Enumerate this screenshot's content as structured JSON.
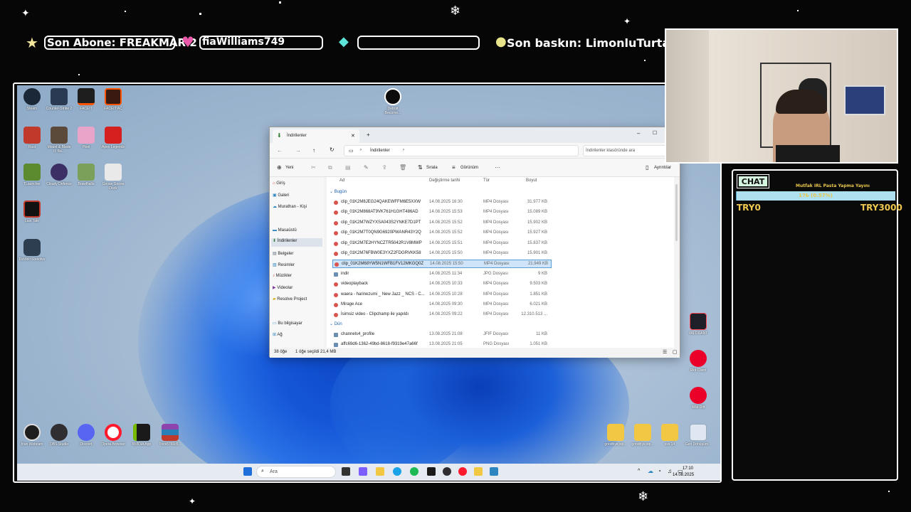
{
  "overlay": {
    "last_sub_label": "Son Abone: FREAKMAR 2",
    "last_tip": "fiaWilliams749",
    "blank_pill": "",
    "last_raid_label": "Son baskın: LimonluTurta",
    "icons": [
      "star-icon",
      "heart-icon",
      "diamond-icon",
      "coin-icon"
    ]
  },
  "desktop": {
    "icons_left": [
      {
        "label": "Steam"
      },
      {
        "label": "Counter-Strike 2"
      },
      {
        "label": "FACEIT"
      },
      {
        "label": "FACEIT AC"
      },
      {
        "label": "Rust"
      },
      {
        "label": "Mount & Blade II: Ba..."
      },
      {
        "label": "Pixel"
      },
      {
        "label": "Apex Legends"
      },
      {
        "label": "TLauncher"
      },
      {
        "label": "Cloudy Defence"
      },
      {
        "label": "Brawlhalla"
      },
      {
        "label": "Goose Goose Duck"
      },
      {
        "label": "Last Tale"
      },
      {
        "label": "DaVinci Resolve"
      }
    ],
    "icon_center": {
      "label": "Detroit Become..."
    },
    "icons_right": [
      {
        "label": "VALORANT"
      },
      {
        "label": "Riot Client"
      },
      {
        "label": "Wild Rift"
      }
    ],
    "icons_bottom": [
      {
        "label": "Iriun Webcam"
      },
      {
        "label": "OBS Studio"
      },
      {
        "label": "Discord"
      },
      {
        "label": "Opera Browser"
      },
      {
        "label": "NVIDIA App"
      },
      {
        "label": "Trick8766c6..."
      }
    ],
    "icons_bottom_right": [
      {
        "label": "goodbye.sip..."
      },
      {
        "label": "goodbye.sip..."
      },
      {
        "label": "sss 14"
      },
      {
        "label": "Geri Dönüşüm..."
      }
    ]
  },
  "explorer": {
    "tab_title": "İndirilenler",
    "breadcrumb": "İndirilenler",
    "search_placeholder": "İndirilenler klasöründe ara",
    "toolbar": {
      "new": "Yeni",
      "sort": "Sırala",
      "view": "Görünüm",
      "more": "···",
      "details": "Ayrıntılar"
    },
    "sidebar": [
      {
        "label": "Giriş",
        "pin": false
      },
      {
        "label": "Galeri",
        "pin": false
      },
      {
        "label": "Murathan - Kişi",
        "pin": false
      },
      {
        "label": "Masaüstü",
        "pin": true
      },
      {
        "label": "İndirilenler",
        "pin": true
      },
      {
        "label": "Belgeler",
        "pin": true
      },
      {
        "label": "Resimler",
        "pin": true
      },
      {
        "label": "Müzikler",
        "pin": true
      },
      {
        "label": "Videolar",
        "pin": true
      },
      {
        "label": "Resolve Project",
        "pin": false
      },
      {
        "label": "Bu bilgisayar",
        "pin": false
      },
      {
        "label": "Ağ",
        "pin": false
      }
    ],
    "columns": [
      "Ad",
      "Değiştirme tarihi",
      "Tür",
      "Boyut"
    ],
    "group_today": "Bugün",
    "group_yesterday": "Dün",
    "files_today": [
      {
        "name": "clip_01K2M8JEG24QAKEWFFM6E5XXW",
        "date": "14.08.2025 16:30",
        "type": "MP4 Dosyası",
        "size": "31.977 KB"
      },
      {
        "name": "clip_01K2M868AT9VK761H1GHT486AD",
        "date": "14.08.2025 15:53",
        "type": "MP4 Dosyası",
        "size": "15.089 KB"
      },
      {
        "name": "clip_01K2M7WZYXSA043S2YNKE7D1PT",
        "date": "14.08.2025 15:52",
        "type": "MP4 Dosyası",
        "size": "15.902 KB"
      },
      {
        "name": "clip_01K2M7T0QN9G6920PWANR43Y2Q",
        "date": "14.08.2025 15:52",
        "type": "MP4 Dosyası",
        "size": "15.927 KB"
      },
      {
        "name": "clip_01K2M7E2HYNCZTR5042R1V8MWP",
        "date": "14.08.2025 15:51",
        "type": "MP4 Dosyası",
        "size": "15.837 KB"
      },
      {
        "name": "clip_01K2M76FBW0E3YXZ2FDGRVKK58",
        "date": "14.08.2025 15:50",
        "type": "MP4 Dosyası",
        "size": "15.901 KB"
      },
      {
        "name": "clip_01K2M68YW5N1WFB1FV12MKGQ0Z",
        "date": "14.08.2025 15:50",
        "type": "MP4 Dosyası",
        "size": "21.949 KB",
        "selected": true
      },
      {
        "name": "indir",
        "date": "14.08.2025 11:34",
        "type": "JPG Dosyası",
        "size": "9 KB"
      },
      {
        "name": "videoplayback",
        "date": "14.08.2025 10:33",
        "type": "MP4 Dosyası",
        "size": "9.503 KB"
      },
      {
        "name": "waera - harinezumi _ New Jazz _ NCS - C...",
        "date": "14.08.2025 10:28",
        "type": "MP4 Dosyası",
        "size": "1.851 KB"
      },
      {
        "name": "Mirage Ace",
        "date": "14.08.2025 09:30",
        "type": "MP4 Dosyası",
        "size": "6.021 KB"
      },
      {
        "name": "İsimsiz video - Clipchamp ile yapıldı",
        "date": "14.08.2025 09:22",
        "type": "MP4 Dosyası",
        "size": "12.310.513 ..."
      }
    ],
    "files_yesterday": [
      {
        "name": "channels4_profile",
        "date": "13.08.2025 21:08",
        "type": "JFIF Dosyası",
        "size": "11 KB"
      },
      {
        "name": "affc69d6-1362-49bd-8618-f9319e47a66f",
        "date": "13.08.2025 21:05",
        "type": "PNG Dosyası",
        "size": "1.051 KB"
      }
    ],
    "status_count": "38 öğe",
    "status_selected": "1 öğe seçildi  21,4 MB"
  },
  "taskbar": {
    "search_placeholder": "Ara",
    "time": "17:10",
    "date": "14.08.2025"
  },
  "chat": {
    "badge": "CHAT",
    "goal_title": "Mutfak IRL Pasta Yapma Yayını",
    "goal_progress_text": "17₺ (0.57%)",
    "goal_progress_fraction": 0.0057,
    "goal_min": "TRY0",
    "goal_max": "TRY3000"
  }
}
